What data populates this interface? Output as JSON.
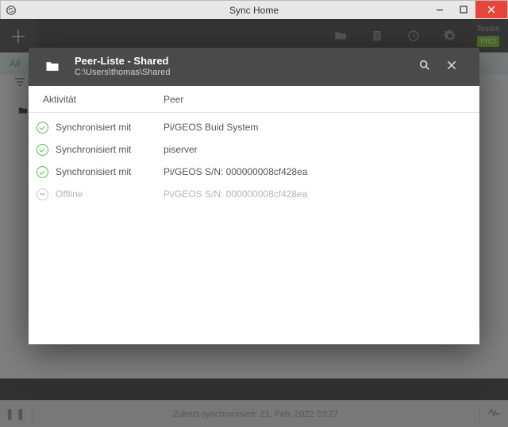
{
  "window": {
    "title": "Sync Home"
  },
  "toolbar": {
    "test_label": "Testen",
    "pro_label": "PRO"
  },
  "tabs": {
    "all": "All"
  },
  "statusbar": {
    "text": "Zuletzt synchronisiert: 21. Feb. 2022 23:27"
  },
  "modal": {
    "title": "Peer-Liste - Shared",
    "path": "C:\\Users\\thomas\\Shared",
    "columns": {
      "activity": "Aktivität",
      "peer": "Peer"
    },
    "rows": [
      {
        "status": "synced",
        "activity": "Synchronisiert mit",
        "peer": "Pi/GEOS Buid System"
      },
      {
        "status": "synced",
        "activity": "Synchronisiert mit",
        "peer": "piserver"
      },
      {
        "status": "synced",
        "activity": "Synchronisiert mit",
        "peer": "Pi/GEOS S/N: 000000008cf428ea"
      },
      {
        "status": "offline",
        "activity": "Offline",
        "peer": "Pi/GEOS S/N: 000000008cf428ea"
      }
    ]
  }
}
